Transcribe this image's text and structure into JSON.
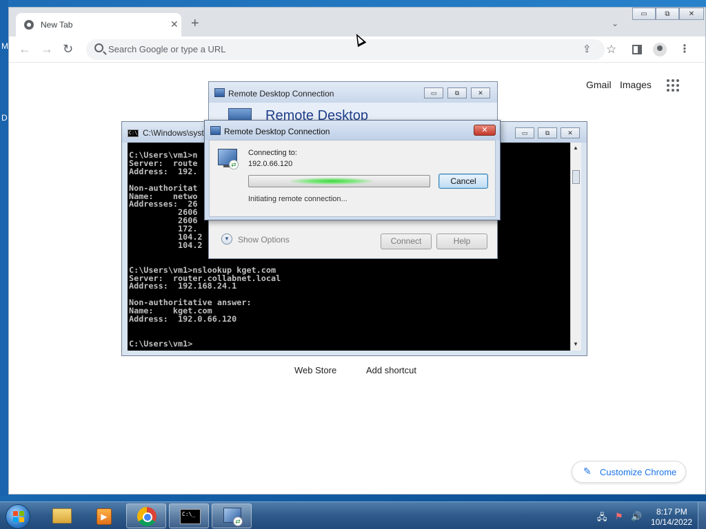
{
  "desktop": {
    "edge_letters": [
      "M",
      "D"
    ]
  },
  "chrome": {
    "tab": {
      "title": "New Tab",
      "close": "✕"
    },
    "new_tab": "+",
    "tab_search": "⌄",
    "window_controls": {
      "minimize": "▭",
      "restore": "⧉",
      "close": "✕"
    },
    "nav": {
      "back": "←",
      "forward": "→",
      "reload": "↻"
    },
    "omnibox": {
      "placeholder": "Search Google or type a URL",
      "share": "⇪"
    },
    "star": "☆",
    "menu": "⋮",
    "ntp": {
      "gmail": "Gmail",
      "images": "Images",
      "web_store": "Web Store",
      "add_shortcut": "Add shortcut",
      "customize": "Customize Chrome",
      "customize_icon": "✎"
    }
  },
  "cmd": {
    "title": "C:\\Windows\\syst",
    "icon_text": "C:\\",
    "controls": {
      "minimize": "▭",
      "restore": "⧉",
      "close": "✕"
    },
    "lines": [
      "C:\\Users\\vm1>n",
      "Server:  route",
      "Address:  192.",
      "",
      "Non-authoritat",
      "Name:    netwo",
      "Addresses:  26",
      "          2606",
      "          2606",
      "          172.",
      "          104.2",
      "          104.2",
      "",
      "",
      "C:\\Users\\vm1>nslookup kget.com",
      "Server:  router.collabnet.local",
      "Address:  192.168.24.1",
      "",
      "Non-authoritative answer:",
      "Name:    kget.com",
      "Address:  192.0.66.120",
      "",
      "",
      "C:\\Users\\vm1>"
    ],
    "scroll_up": "▲",
    "scroll_down": "▼"
  },
  "rdc_main": {
    "title": "Remote Desktop Connection",
    "heading": "Remote Desktop",
    "show_options": "Show Options",
    "show_options_icon": "▼",
    "connect": "Connect",
    "help": "Help",
    "controls": {
      "minimize": "▭",
      "restore": "⧉",
      "close": "✕"
    }
  },
  "rdc_dialog": {
    "title": "Remote Desktop Connection",
    "close": "✕",
    "connecting_label": "Connecting to:",
    "server": "192.0.66.120",
    "status": "Initiating remote connection...",
    "cancel": "Cancel",
    "badge": "⇄"
  },
  "taskbar": {
    "media_glyph": "▶",
    "cmd_glyph": "C:\\_",
    "rdc_badge": "⇄",
    "tray": {
      "network": "🖧",
      "flag": "⚑",
      "volume": "🔊"
    },
    "time": "8:17 PM",
    "date": "10/14/2022"
  }
}
